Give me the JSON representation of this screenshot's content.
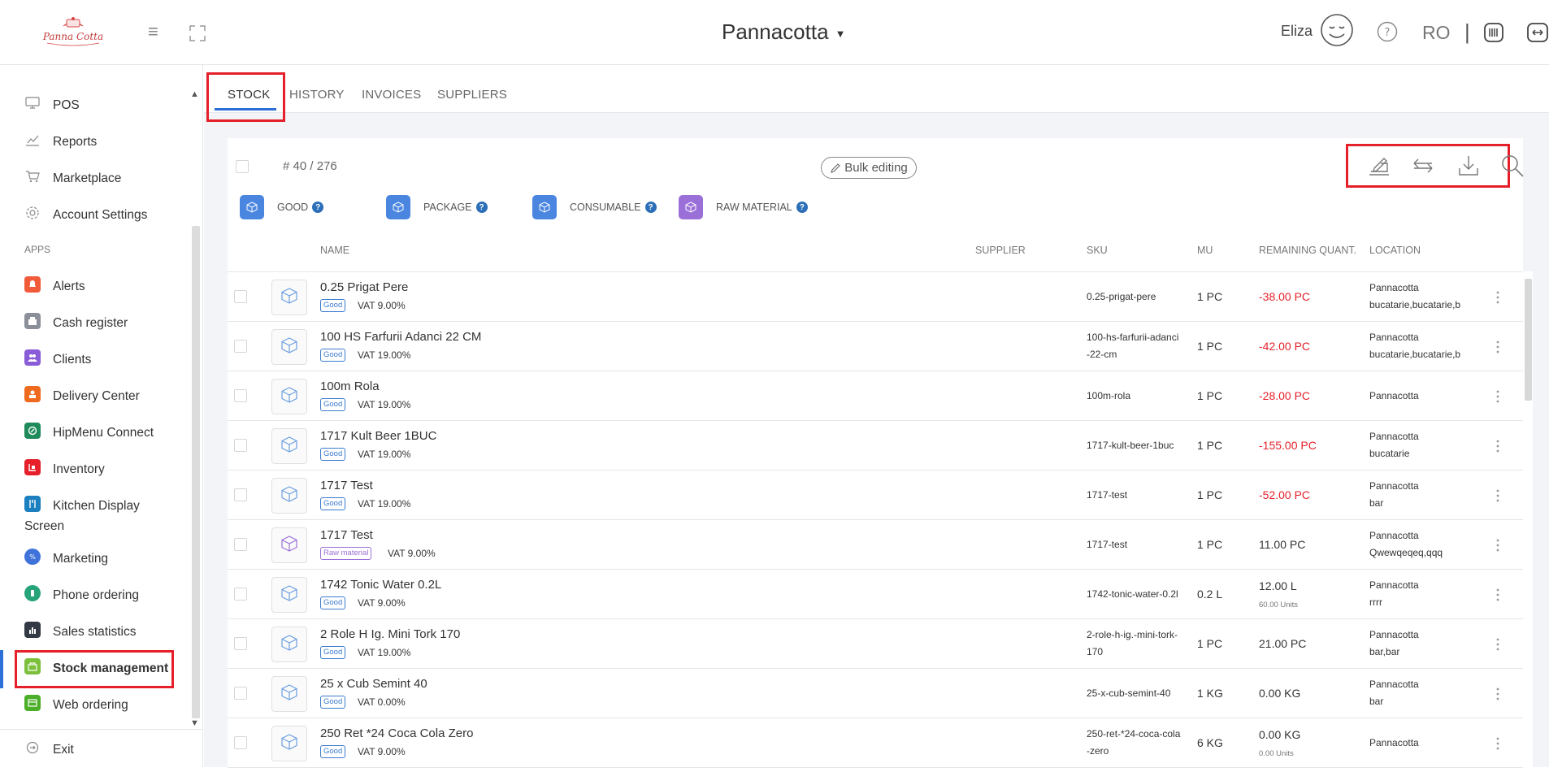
{
  "header": {
    "restaurant": "Pannacotta",
    "user": "Eliza",
    "lang": "RO",
    "sep": "|"
  },
  "sidebar": {
    "top_items": [
      {
        "label": "POS",
        "icon": "pos-icon"
      },
      {
        "label": "Reports",
        "icon": "reports-icon"
      },
      {
        "label": "Marketplace",
        "icon": "marketplace-icon"
      },
      {
        "label": "Account Settings",
        "icon": "gear-icon"
      }
    ],
    "apps_heading": "APPS",
    "apps": [
      {
        "label": "Alerts",
        "color": "#f25b3a"
      },
      {
        "label": "Cash register",
        "color": "#8a8f99"
      },
      {
        "label": "Clients",
        "color": "#8a5cd8"
      },
      {
        "label": "Delivery Center",
        "color": "#ee6a1f"
      },
      {
        "label": "HipMenu Connect",
        "color": "#1f8a5a"
      },
      {
        "label": "Inventory",
        "color": "#e5202a"
      },
      {
        "label": "Kitchen Display",
        "label2": "Screen",
        "color": "#1c7fbf"
      },
      {
        "label": "Marketing",
        "color": "#3f73d9"
      },
      {
        "label": "Phone ordering",
        "color": "#27a37a"
      },
      {
        "label": "Sales statistics",
        "color": "#333a45"
      },
      {
        "label": "Stock management",
        "color": "#7cbf3a"
      },
      {
        "label": "Web ordering",
        "color": "#4caf2a"
      }
    ],
    "exit": "Exit"
  },
  "tabs": [
    "STOCK",
    "HISTORY",
    "INVOICES",
    "SUPPLIERS"
  ],
  "toolbar": {
    "count": "# 40 / 276",
    "bulk_label": "Bulk editing"
  },
  "legend": [
    {
      "label": "GOOD",
      "color": "#4a86e0"
    },
    {
      "label": "PACKAGE",
      "color": "#4a86e0"
    },
    {
      "label": "CONSUMABLE",
      "color": "#4a86e0"
    },
    {
      "label": "RAW MATERIAL",
      "color": "#9b6fd8"
    }
  ],
  "columns": {
    "name": "NAME",
    "supplier": "SUPPLIER",
    "sku": "SKU",
    "mu": "MU",
    "remaining": "REMAINING QUANT.",
    "location": "LOCATION"
  },
  "rows": [
    {
      "name": "0.25 Prigat Pere",
      "type": "Good",
      "vat": "VAT 9.00%",
      "sku": [
        "0.25-prigat-pere"
      ],
      "mu": "1 PC",
      "qty": "-38.00 PC",
      "neg": true,
      "units": "",
      "loc": [
        "Pannacotta",
        "bucatarie,bucatarie,b"
      ]
    },
    {
      "name": "100 HS Farfurii Adanci 22 CM",
      "type": "Good",
      "vat": "VAT 19.00%",
      "sku": [
        "100-hs-farfurii-adanci",
        "-22-cm"
      ],
      "mu": "1 PC",
      "qty": "-42.00 PC",
      "neg": true,
      "units": "",
      "loc": [
        "Pannacotta",
        "bucatarie,bucatarie,b"
      ]
    },
    {
      "name": "100m Rola",
      "type": "Good",
      "vat": "VAT 19.00%",
      "sku": [
        "100m-rola"
      ],
      "mu": "1 PC",
      "qty": "-28.00 PC",
      "neg": true,
      "units": "",
      "loc": [
        "Pannacotta"
      ]
    },
    {
      "name": "1717 Kult Beer 1BUC",
      "type": "Good",
      "vat": "VAT 19.00%",
      "sku": [
        "1717-kult-beer-1buc"
      ],
      "mu": "1 PC",
      "qty": "-155.00 PC",
      "neg": true,
      "units": "",
      "loc": [
        "Pannacotta",
        "bucatarie"
      ]
    },
    {
      "name": "1717 Test",
      "type": "Good",
      "vat": "VAT 19.00%",
      "sku": [
        "1717-test"
      ],
      "mu": "1 PC",
      "qty": "-52.00 PC",
      "neg": true,
      "units": "",
      "loc": [
        "Pannacotta",
        "bar"
      ]
    },
    {
      "name": "1717 Test",
      "type": "Raw material",
      "vat": "VAT 9.00%",
      "sku": [
        "1717-test"
      ],
      "mu": "1 PC",
      "qty": "11.00 PC",
      "neg": false,
      "units": "",
      "loc": [
        "Pannacotta",
        "Qwewqeqeq,qqq"
      ]
    },
    {
      "name": "1742 Tonic Water 0.2L",
      "type": "Good",
      "vat": "VAT 9.00%",
      "sku": [
        "1742-tonic-water-0.2l"
      ],
      "mu": "0.2 L",
      "qty": "12.00 L",
      "neg": false,
      "units": "60.00 Units",
      "loc": [
        "Pannacotta",
        "rrrr"
      ]
    },
    {
      "name": "2 Role H Ig. Mini Tork 170",
      "type": "Good",
      "vat": "VAT 19.00%",
      "sku": [
        "2-role-h-ig.-mini-tork-",
        "170"
      ],
      "mu": "1 PC",
      "qty": "21.00 PC",
      "neg": false,
      "units": "",
      "loc": [
        "Pannacotta",
        "bar,bar"
      ]
    },
    {
      "name": "25 x Cub Semint 40",
      "type": "Good",
      "vat": "VAT 0.00%",
      "sku": [
        "25-x-cub-semint-40"
      ],
      "mu": "1 KG",
      "qty": "0.00 KG",
      "neg": false,
      "units": "",
      "loc": [
        "Pannacotta",
        "bar"
      ]
    },
    {
      "name": "250 Ret *24 Coca Cola Zero",
      "type": "Good",
      "vat": "VAT 9.00%",
      "sku": [
        "250-ret-*24-coca-cola",
        "-zero"
      ],
      "mu": "6 KG",
      "qty": "0.00 KG",
      "neg": false,
      "units": "0.00 Units",
      "loc": [
        "Pannacotta"
      ]
    }
  ]
}
